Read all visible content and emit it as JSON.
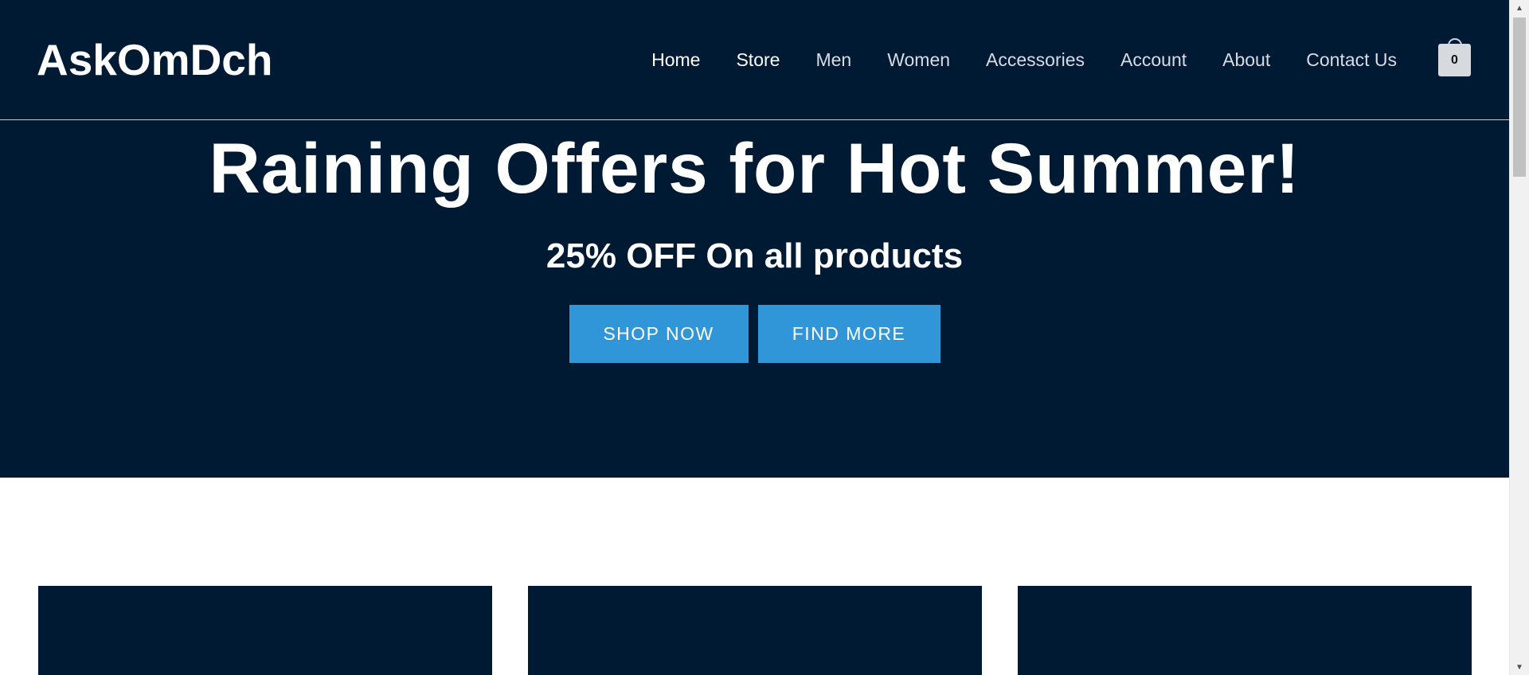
{
  "header": {
    "brand": "AskOmDch",
    "nav": [
      {
        "label": "Home",
        "active": true
      },
      {
        "label": "Store",
        "active": true
      },
      {
        "label": "Men",
        "active": false
      },
      {
        "label": "Women",
        "active": false
      },
      {
        "label": "Accessories",
        "active": false
      },
      {
        "label": "Account",
        "active": false
      },
      {
        "label": "About",
        "active": false
      },
      {
        "label": "Contact Us",
        "active": false
      }
    ],
    "cart_count": "0",
    "cart_icon": "shopping-bag-icon"
  },
  "hero": {
    "title": "Raining Offers for Hot Summer!",
    "subtitle": "25% OFF On all products",
    "primary_button": "SHOP NOW",
    "secondary_button": "FIND MORE"
  },
  "colors": {
    "header_bg": "#001a33",
    "button_bg": "#3196d8",
    "text_primary": "#ffffff",
    "nav_text": "#d6dce4"
  }
}
